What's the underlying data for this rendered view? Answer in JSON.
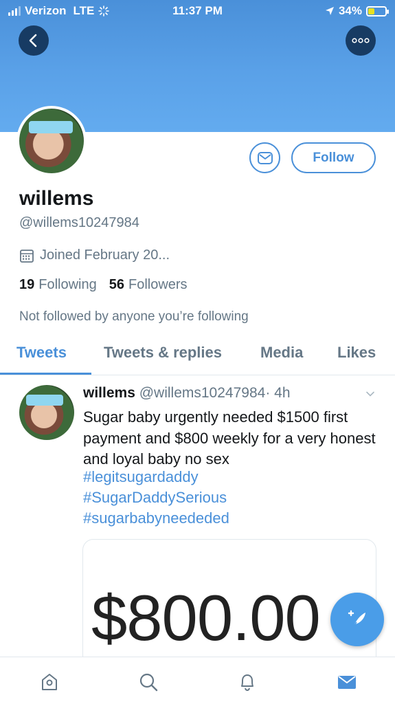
{
  "status_bar": {
    "carrier": "Verizon",
    "network": "LTE",
    "time": "11:37 PM",
    "battery": "34%",
    "battery_level": 0.34
  },
  "header": {
    "back_icon": "chevron-left-icon",
    "more_icon": "ellipsis-icon"
  },
  "profile": {
    "name": "willems",
    "handle": "@willems10247984",
    "joined": "Joined February 20...",
    "following_count": "19",
    "following_label": "Following",
    "followers_count": "56",
    "followers_label": "Followers",
    "not_followed": "Not followed by anyone you’re following",
    "follow_button": "Follow"
  },
  "tabs": [
    {
      "label": "Tweets",
      "active": true
    },
    {
      "label": "Tweets & replies",
      "active": false
    },
    {
      "label": "Media",
      "active": false
    },
    {
      "label": "Likes",
      "active": false
    }
  ],
  "tweet": {
    "author": "willems",
    "handle": "@willems10247984",
    "time": "· 4h",
    "text": "Sugar baby urgently needed $1500 first payment and $800 weekly for a very honest and loyal baby no sex",
    "hashtags": [
      "#legitsugardaddy",
      "#SugarDaddySerious",
      "#sugarbabyneededed"
    ],
    "media_text": "$800.00"
  },
  "bottom_nav": [
    "home-icon",
    "search-icon",
    "notifications-icon",
    "messages-icon"
  ],
  "colors": {
    "accent": "#4a90d9",
    "banner": "#5aa1e8",
    "dark_button": "#173b63"
  }
}
